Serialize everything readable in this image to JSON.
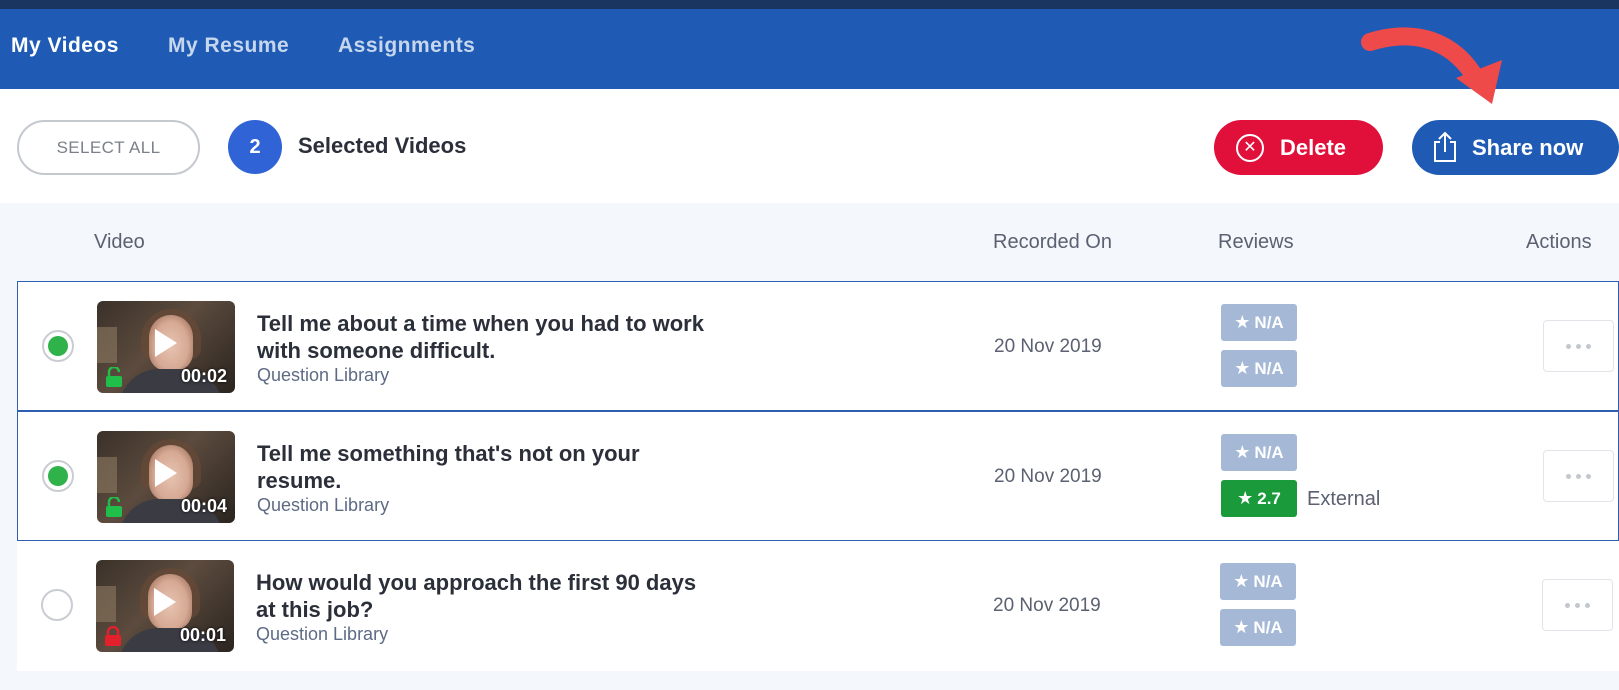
{
  "nav": {
    "tabs": [
      {
        "label": "My Videos",
        "active": true
      },
      {
        "label": "My Resume",
        "active": false
      },
      {
        "label": "Assignments",
        "active": false
      }
    ]
  },
  "toolbar": {
    "select_all_label": "SELECT ALL",
    "selected_count": "2",
    "selected_label": "Selected Videos",
    "delete_label": "Delete",
    "share_label": "Share now"
  },
  "table": {
    "headers": {
      "video": "Video",
      "recorded_on": "Recorded On",
      "reviews": "Reviews",
      "actions": "Actions"
    },
    "rows": [
      {
        "selected": true,
        "title": "Tell me about a time when you had to work with someone difficult.",
        "source": "Question Library",
        "duration": "00:02",
        "locked": false,
        "date": "20 Nov 2019",
        "reviews": [
          {
            "value": "N/A",
            "color": "#a5b9d6"
          },
          {
            "value": "N/A",
            "color": "#a5b9d6"
          }
        ]
      },
      {
        "selected": true,
        "title": "Tell me something that's not on your resume.",
        "source": "Question Library",
        "duration": "00:04",
        "locked": false,
        "date": "20 Nov 2019",
        "reviews": [
          {
            "value": "N/A",
            "color": "#a5b9d6"
          },
          {
            "value": "2.7",
            "color": "#1a9a3a",
            "label": "External"
          }
        ]
      },
      {
        "selected": false,
        "title": "How would you approach the first 90 days at this job?",
        "source": "Question Library",
        "duration": "00:01",
        "locked": true,
        "date": "20 Nov 2019",
        "reviews": [
          {
            "value": "N/A",
            "color": "#a5b9d6"
          },
          {
            "value": "N/A",
            "color": "#a5b9d6"
          }
        ]
      }
    ]
  },
  "colors": {
    "nav_bg": "#1f5bb5",
    "active_tab_underline": "#1fae4b",
    "delete": "#e0103a",
    "share": "#1f5bb5",
    "selected_dot": "#2fb24a",
    "unlocked": "#1fbf4a",
    "locked": "#e5202d",
    "arrow": "#ef4a4a"
  }
}
